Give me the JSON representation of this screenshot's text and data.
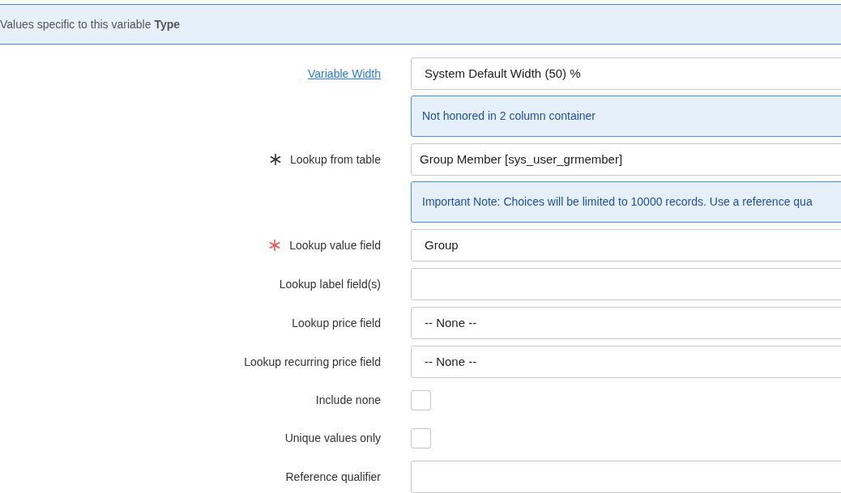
{
  "section_header": {
    "text": "Values specific to this variable **Type**"
  },
  "rows": [
    {
      "kind": "select",
      "label": "Variable Width",
      "label_link": true,
      "value": "System Default Width (50) %",
      "note": "Not honored in 2 column container"
    },
    {
      "kind": "reference",
      "label": "Lookup from table",
      "required": true,
      "filled": true,
      "value": "Group Member [sys_user_grmember]",
      "note": "Important Note: Choices will be limited to 10000 records. Use a reference qua"
    },
    {
      "kind": "text",
      "label": "Lookup value field",
      "required": true,
      "filled": false,
      "value": "Group"
    },
    {
      "kind": "text",
      "label": "Lookup label field(s)"
    },
    {
      "kind": "select",
      "label": "Lookup price field",
      "value": "-- None --"
    },
    {
      "kind": "select",
      "label": "Lookup recurring price field",
      "value": "-- None --"
    },
    {
      "kind": "checkbox",
      "label": "Include none",
      "checked": false
    },
    {
      "kind": "checkbox",
      "label": "Unique values only",
      "checked": false
    },
    {
      "kind": "text",
      "label": "Reference qualifier"
    }
  ]
}
